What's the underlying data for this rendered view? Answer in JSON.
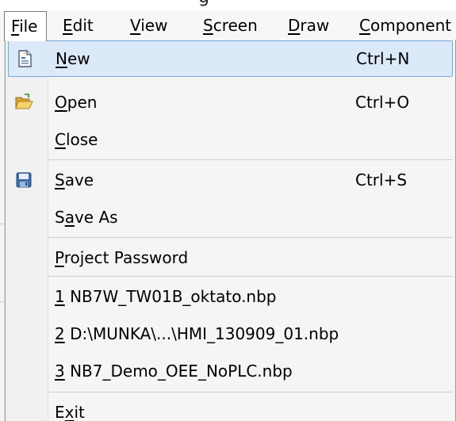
{
  "title_fragment": "g",
  "menubar": {
    "items": [
      {
        "mnemonic": "F",
        "rest": "ile"
      },
      {
        "mnemonic": "E",
        "rest": "dit"
      },
      {
        "mnemonic": "V",
        "rest": "iew"
      },
      {
        "mnemonic": "S",
        "rest": "creen"
      },
      {
        "mnemonic": "D",
        "rest": "raw"
      },
      {
        "mnemonic": "C",
        "rest": "omponent"
      }
    ]
  },
  "file_menu": {
    "new": {
      "pre": "",
      "mnemonic": "N",
      "post": "ew",
      "shortcut": "Ctrl+N",
      "icon": "new-document-icon"
    },
    "open": {
      "pre": "",
      "mnemonic": "O",
      "post": "pen",
      "shortcut": "Ctrl+O",
      "icon": "open-folder-icon"
    },
    "close": {
      "pre": "",
      "mnemonic": "C",
      "post": "lose"
    },
    "save": {
      "pre": "",
      "mnemonic": "S",
      "post": "ave",
      "shortcut": "Ctrl+S",
      "icon": "floppy-disk-icon"
    },
    "save_as": {
      "pre": "S",
      "mnemonic": "a",
      "post": "ve As"
    },
    "project_password": {
      "pre": "",
      "mnemonic": "P",
      "post": "roject Password"
    },
    "recent": [
      {
        "mnemonic": "1",
        "post": " NB7W_TW01B_oktato.nbp"
      },
      {
        "mnemonic": "2",
        "post": " D:\\MUNKA\\...\\HMI_130909_01.nbp"
      },
      {
        "mnemonic": "3",
        "post": " NB7_Demo_OEE_NoPLC.nbp"
      }
    ],
    "exit": {
      "pre": "E",
      "mnemonic": "x",
      "post": "it"
    }
  },
  "colors": {
    "highlight_fill": "#dbe9f8",
    "highlight_border": "#76a9df",
    "menu_background": "#f5f5f5"
  }
}
